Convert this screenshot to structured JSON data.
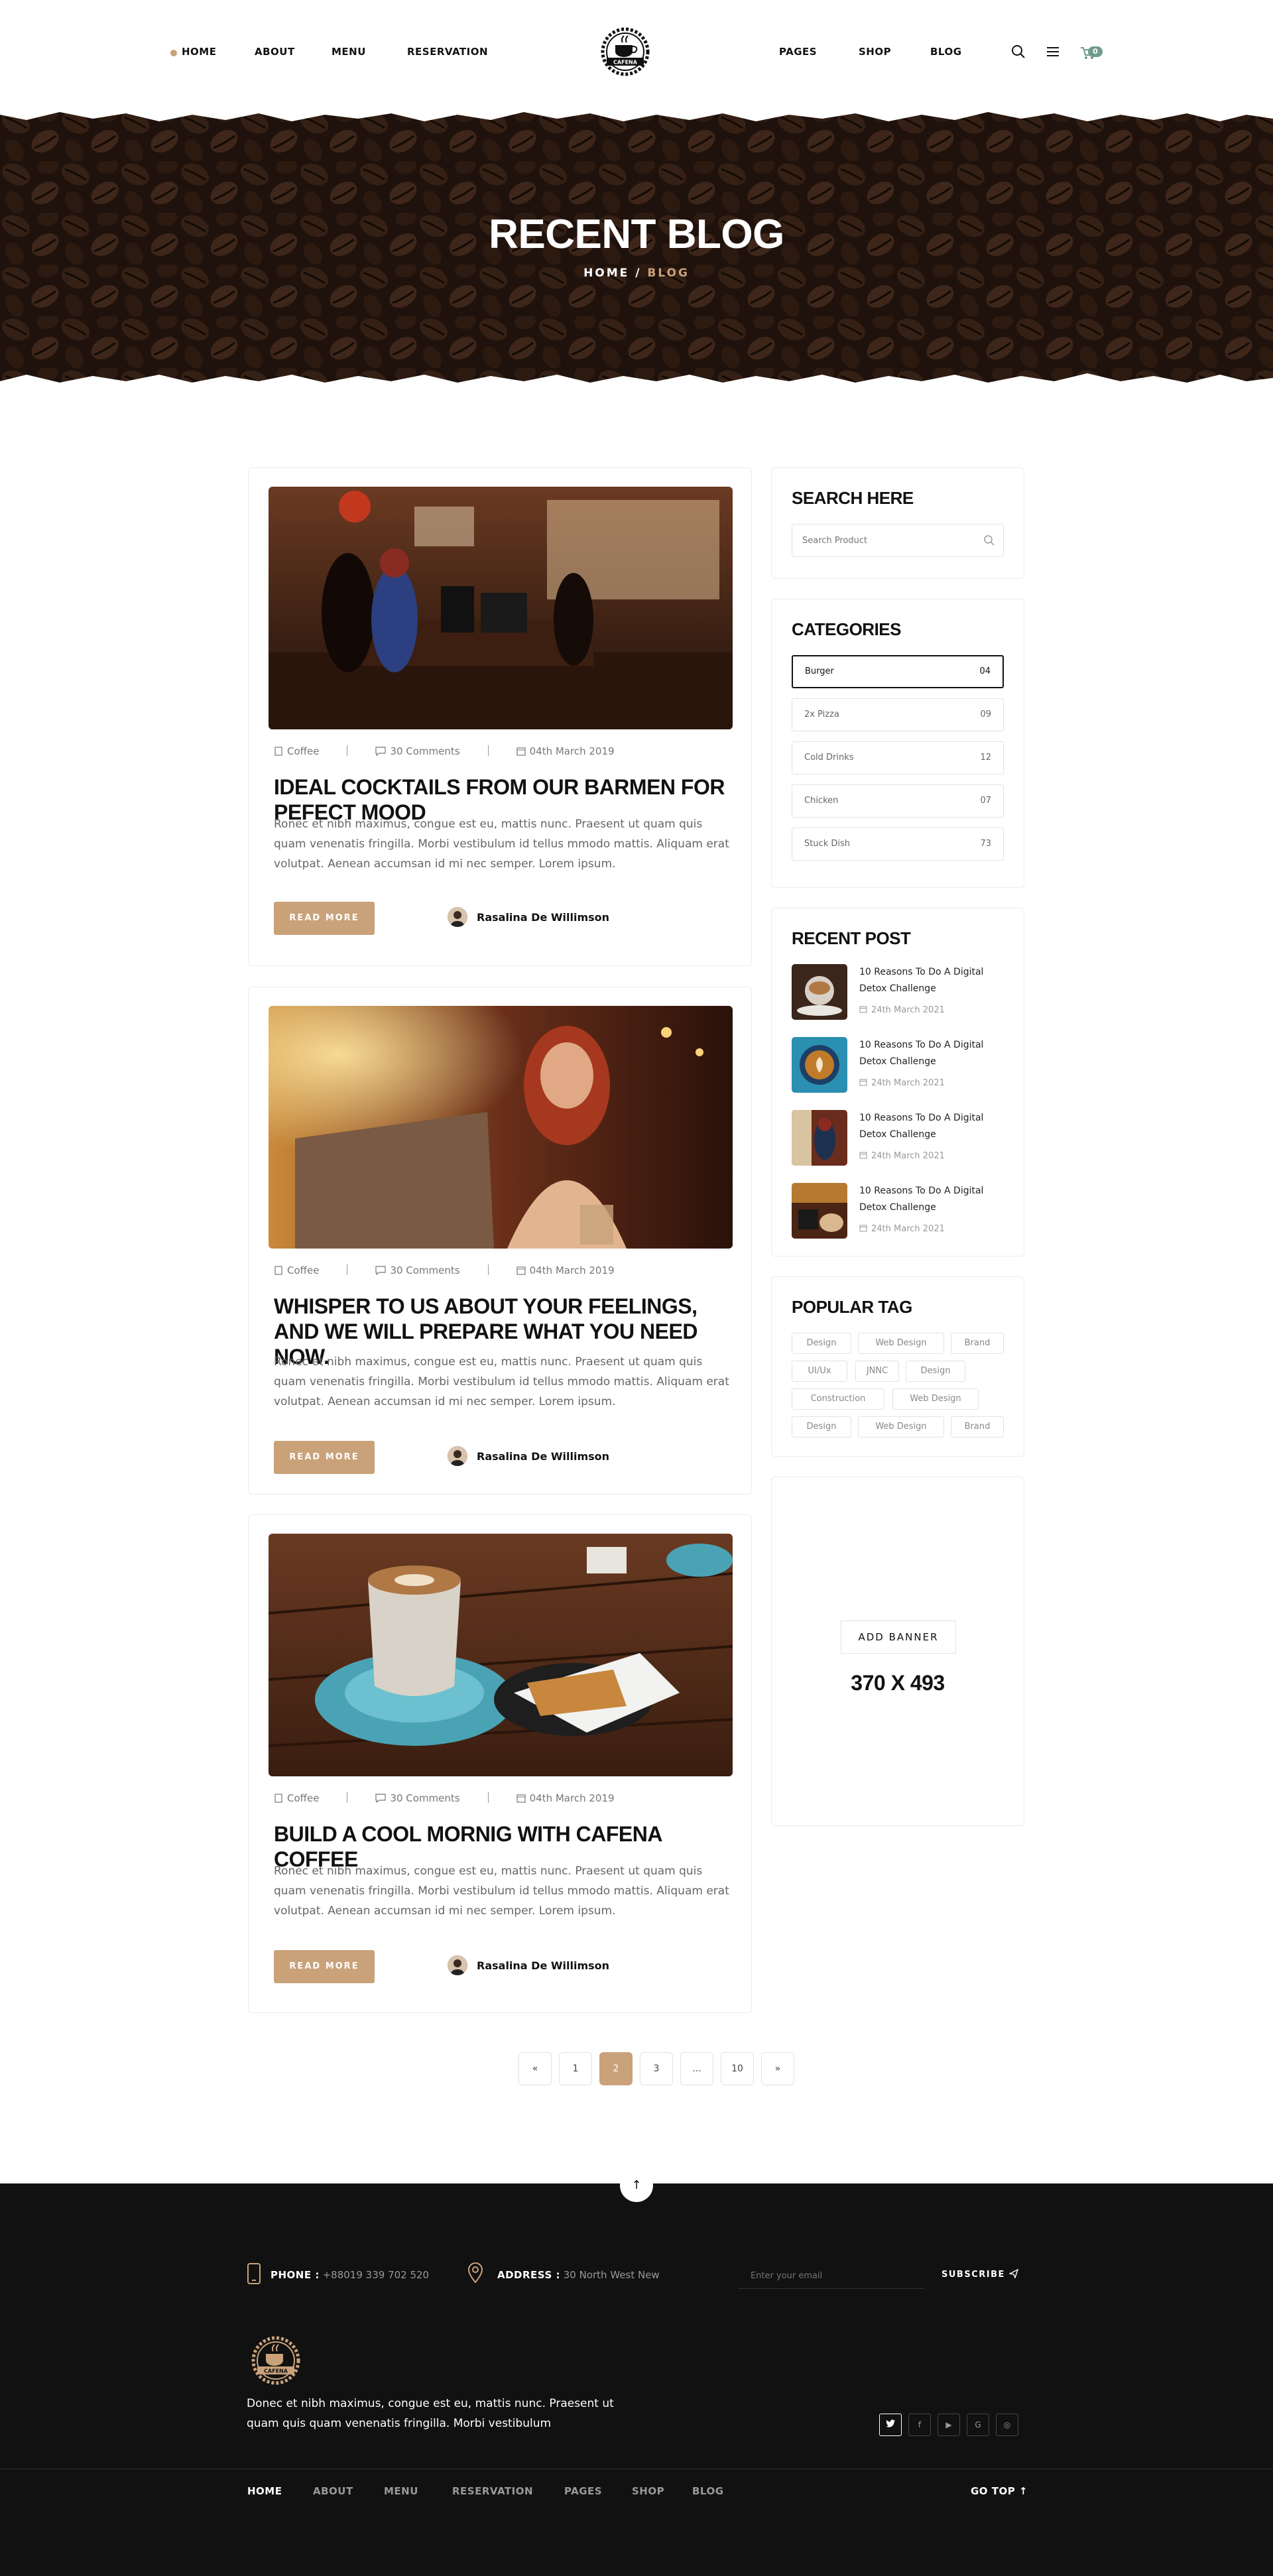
{
  "header": {
    "nav_left": [
      "Home",
      "About",
      "Menu",
      "Reservation"
    ],
    "nav_right": [
      "Pages",
      "Shop",
      "Blog"
    ],
    "logo_text": "CAFENA",
    "cart_count": "0",
    "accent_color": "#c9a27a"
  },
  "hero": {
    "title": "Recent Blog",
    "breadcrumb_home": "HOME",
    "breadcrumb_sep": "/",
    "breadcrumb_current": "BLOG"
  },
  "posts": [
    {
      "category": "Coffee",
      "comments": "30 Comments",
      "date": "04th March 2019",
      "title": "Ideal cocktails from our barmen for pefect mood",
      "excerpt": "Ronec et nibh maximus, congue est eu, mattis nunc. Praesent ut quam quis quam venenatis fringilla. Morbi vestibulum id tellus mmodo mattis. Aliquam erat volutpat. Aenean accumsan id mi nec semper. Lorem ipsum.",
      "button": "Read More",
      "author": "Rasalina De Willimson"
    },
    {
      "category": "Coffee",
      "comments": "30 Comments",
      "date": "04th March 2019",
      "title": "Whisper to us about your feelings, and we will prepare what you need now.",
      "excerpt": "Ronec et nibh maximus, congue est eu, mattis nunc. Praesent ut quam quis quam venenatis fringilla. Morbi vestibulum id tellus mmodo mattis. Aliquam erat volutpat. Aenean accumsan id mi nec semper. Lorem ipsum.",
      "button": "Read More",
      "author": "Rasalina De Willimson"
    },
    {
      "category": "Coffee",
      "comments": "30 Comments",
      "date": "04th March 2019",
      "title": "Build a cool mornig with cafena coffee",
      "excerpt": "Ronec et nibh maximus, congue est eu, mattis nunc. Praesent ut quam quis quam venenatis fringilla. Morbi vestibulum id tellus mmodo mattis. Aliquam erat volutpat. Aenean accumsan id mi nec semper. Lorem ipsum.",
      "button": "Read More",
      "author": "Rasalina De Willimson"
    }
  ],
  "sidebar": {
    "search": {
      "title": "Search Here",
      "placeholder": "Search Product"
    },
    "categories": {
      "title": "Categories",
      "items": [
        {
          "name": "Burger",
          "count": "04"
        },
        {
          "name": "2x Pizza",
          "count": "09"
        },
        {
          "name": "Cold Drinks",
          "count": "12"
        },
        {
          "name": "Chicken",
          "count": "07"
        },
        {
          "name": "Stuck Dish",
          "count": "73"
        }
      ]
    },
    "recent_posts": {
      "title": "Recent Post",
      "items": [
        {
          "title": "10 Reasons To Do A Digital Detox Challenge",
          "date": "24th March 2021"
        },
        {
          "title": "10 Reasons To Do A Digital Detox Challenge",
          "date": "24th March 2021"
        },
        {
          "title": "10 Reasons To Do A Digital Detox Challenge",
          "date": "24th March 2021"
        },
        {
          "title": "10 Reasons To Do A Digital Detox Challenge",
          "date": "24th March 2021"
        }
      ]
    },
    "tags": {
      "title": "Popular Tag",
      "items": [
        "Design",
        "Web Design",
        "Brand",
        "UI/Ux",
        "JNNC",
        "Design",
        "Construction",
        "Web Design",
        "Design",
        "Web Design",
        "Brand"
      ]
    },
    "banner": {
      "button": "ADD BANNER",
      "size": "370 x 493"
    }
  },
  "pagination": [
    "«",
    "1",
    "2",
    "3",
    "...",
    "10",
    "»"
  ],
  "pagination_active": "2",
  "footer": {
    "phone_label": "PHONE :",
    "phone": "+88019 339 702 520",
    "address_label": "ADDRESS :",
    "address": "30 North West New",
    "email_placeholder": "Enter your email",
    "subscribe": "SUBSCRIBE",
    "logo_text": "CAFENA",
    "about": "Donec et nibh maximus, congue est eu, mattis nunc. Praesent ut quam quis quam venenatis fringilla. Morbi vestibulum",
    "social": [
      "twitter",
      "facebook",
      "youtube",
      "google",
      "instagram"
    ],
    "nav": [
      "Home",
      "About",
      "Menu",
      "Reservation",
      "Pages",
      "Shop",
      "Blog"
    ],
    "go_top": "Go Top"
  }
}
